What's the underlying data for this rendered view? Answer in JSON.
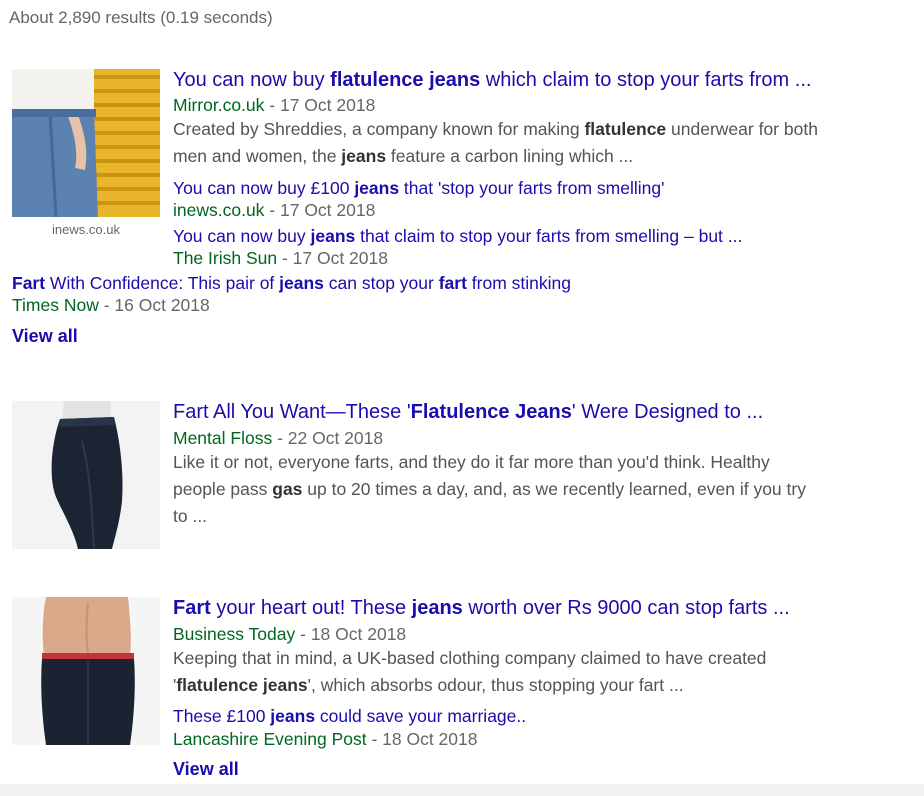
{
  "stats": "About 2,890 results (0.19 seconds)",
  "groups": [
    {
      "thumb_caption": "inews.co.uk",
      "title": {
        "a": "You can now buy ",
        "b": "flatulence jeans",
        "c": " which claim to stop your farts from ..."
      },
      "source": "Mirror.co.uk",
      "date": " - 17 Oct 2018",
      "snippet": {
        "l1a": "Created by Shreddies, a company known for making ",
        "l1b": "flatulence",
        "l1c": " underwear for both",
        "l2a": "men and women, the ",
        "l2b": "jeans",
        "l2c": " feature a carbon lining which ..."
      },
      "related": [
        {
          "a": "You can now buy £100 ",
          "b": "jeans",
          "c": " that 'stop your farts from smelling'",
          "source": "inews.co.uk",
          "date": " - 17 Oct 2018"
        },
        {
          "a": "You can now buy ",
          "b": "jeans",
          "c": " that claim to stop your farts from smelling – but ...",
          "source": "The Irish Sun",
          "date": " - 17 Oct 2018"
        },
        {
          "a": "Fart",
          "b": " With Confidence: This pair of ",
          "c": "jeans",
          "d": " can stop your ",
          "e": "fart",
          "f": " from stinking",
          "source": "Times Now",
          "date": " - 16 Oct 2018"
        }
      ],
      "view_all": "View all"
    },
    {
      "title": {
        "a": "Fart All You Want—These '",
        "b": "Flatulence Jeans",
        "c": "' Were Designed to ..."
      },
      "source": "Mental Floss",
      "date": " - 22 Oct 2018",
      "snippet": {
        "l1": "Like it or not, everyone farts, and they do it far more than you'd think. Healthy",
        "l2a": "people pass ",
        "l2b": "gas",
        "l2c": " up to 20 times a day, and, as we recently learned, even if you try",
        "l3": "to ..."
      }
    },
    {
      "title": {
        "a": "Fart",
        "b": " your heart out! These ",
        "c": "jeans",
        "d": " worth over Rs 9000 can stop farts ..."
      },
      "source": "Business Today",
      "date": " - 18 Oct 2018",
      "snippet": {
        "l1": "Keeping that in mind, a UK-based clothing company claimed to have created",
        "l2a": "'",
        "l2b": "flatulence jeans",
        "l2c": "', which absorbs odour, thus stopping your fart ..."
      },
      "related": [
        {
          "a": "These £100 ",
          "b": "jeans",
          "c": " could save your marriage..",
          "source": "Lancashire Evening Post",
          "date": " - 18 Oct 2018"
        }
      ],
      "view_all": "View all"
    }
  ]
}
